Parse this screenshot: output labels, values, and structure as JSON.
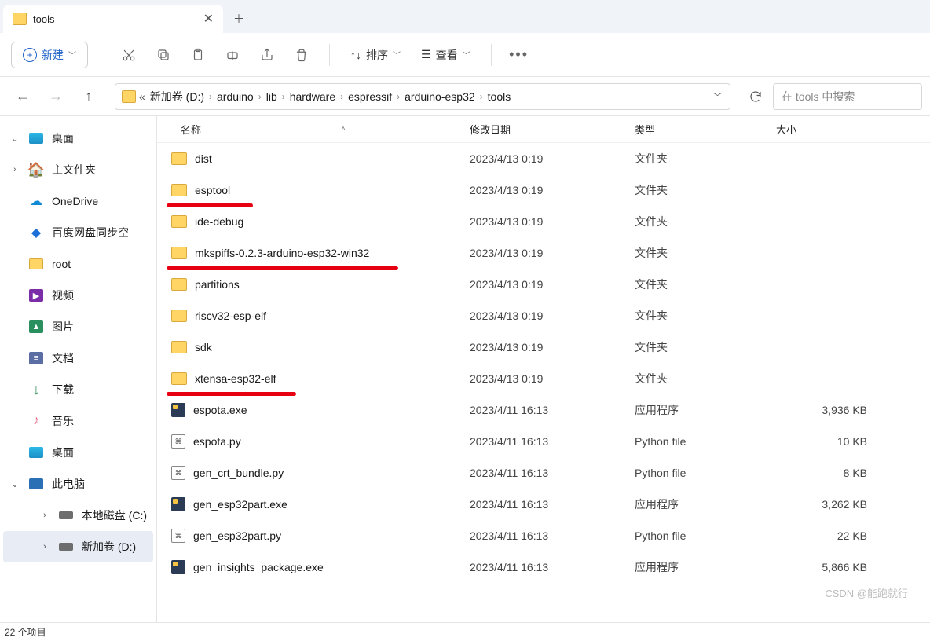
{
  "tab": {
    "title": "tools"
  },
  "toolbar": {
    "new_label": "新建",
    "sort_label": "排序",
    "view_label": "查看"
  },
  "breadcrumbs": {
    "prefix": "«",
    "segments": [
      "新加卷 (D:)",
      "arduino",
      "lib",
      "hardware",
      "espressif",
      "arduino-esp32",
      "tools"
    ]
  },
  "search": {
    "placeholder": "在 tools 中搜索"
  },
  "sidebar": [
    {
      "chev": "down",
      "icon": "desktop",
      "label": "桌面",
      "indent": false,
      "selected": false
    },
    {
      "chev": "right",
      "icon": "home",
      "label": "主文件夹",
      "indent": false,
      "selected": false
    },
    {
      "chev": "none",
      "icon": "onedrive",
      "label": "OneDrive",
      "indent": false,
      "selected": false
    },
    {
      "chev": "none",
      "icon": "baidu",
      "label": "百度网盘同步空",
      "indent": false,
      "selected": false
    },
    {
      "chev": "none",
      "icon": "folder",
      "label": "root",
      "indent": false,
      "selected": false
    },
    {
      "chev": "none",
      "icon": "video",
      "label": "视频",
      "indent": false,
      "selected": false
    },
    {
      "chev": "none",
      "icon": "image",
      "label": "图片",
      "indent": false,
      "selected": false
    },
    {
      "chev": "none",
      "icon": "doc",
      "label": "文档",
      "indent": false,
      "selected": false
    },
    {
      "chev": "none",
      "icon": "download",
      "label": "下载",
      "indent": false,
      "selected": false
    },
    {
      "chev": "none",
      "icon": "music",
      "label": "音乐",
      "indent": false,
      "selected": false
    },
    {
      "chev": "none",
      "icon": "desktop",
      "label": "桌面",
      "indent": false,
      "selected": false
    },
    {
      "chev": "down",
      "icon": "pc",
      "label": "此电脑",
      "indent": false,
      "selected": false
    },
    {
      "chev": "right",
      "icon": "disk",
      "label": "本地磁盘 (C:)",
      "indent": true,
      "selected": false
    },
    {
      "chev": "right",
      "icon": "disk",
      "label": "新加卷 (D:)",
      "indent": true,
      "selected": true
    }
  ],
  "columns": {
    "name": "名称",
    "date": "修改日期",
    "type": "类型",
    "size": "大小"
  },
  "files": [
    {
      "icon": "folder",
      "name": "dist",
      "date": "2023/4/13 0:19",
      "type": "文件夹",
      "size": "",
      "underline": false
    },
    {
      "icon": "folder",
      "name": "esptool",
      "date": "2023/4/13 0:19",
      "type": "文件夹",
      "size": "",
      "underline": true,
      "uw": 110
    },
    {
      "icon": "folder",
      "name": "ide-debug",
      "date": "2023/4/13 0:19",
      "type": "文件夹",
      "size": "",
      "underline": false
    },
    {
      "icon": "folder",
      "name": "mkspiffs-0.2.3-arduino-esp32-win32",
      "date": "2023/4/13 0:19",
      "type": "文件夹",
      "size": "",
      "underline": true,
      "uw": 295
    },
    {
      "icon": "folder",
      "name": "partitions",
      "date": "2023/4/13 0:19",
      "type": "文件夹",
      "size": "",
      "underline": false
    },
    {
      "icon": "folder",
      "name": "riscv32-esp-elf",
      "date": "2023/4/13 0:19",
      "type": "文件夹",
      "size": "",
      "underline": false
    },
    {
      "icon": "folder",
      "name": "sdk",
      "date": "2023/4/13 0:19",
      "type": "文件夹",
      "size": "",
      "underline": false
    },
    {
      "icon": "folder",
      "name": "xtensa-esp32-elf",
      "date": "2023/4/13 0:19",
      "type": "文件夹",
      "size": "",
      "underline": true,
      "uw": 165
    },
    {
      "icon": "exe",
      "name": "espota.exe",
      "date": "2023/4/11 16:13",
      "type": "应用程序",
      "size": "3,936 KB",
      "underline": false
    },
    {
      "icon": "py",
      "name": "espota.py",
      "date": "2023/4/11 16:13",
      "type": "Python file",
      "size": "10 KB",
      "underline": false
    },
    {
      "icon": "py",
      "name": "gen_crt_bundle.py",
      "date": "2023/4/11 16:13",
      "type": "Python file",
      "size": "8 KB",
      "underline": false
    },
    {
      "icon": "exe",
      "name": "gen_esp32part.exe",
      "date": "2023/4/11 16:13",
      "type": "应用程序",
      "size": "3,262 KB",
      "underline": false
    },
    {
      "icon": "py",
      "name": "gen_esp32part.py",
      "date": "2023/4/11 16:13",
      "type": "Python file",
      "size": "22 KB",
      "underline": false
    },
    {
      "icon": "exe",
      "name": "gen_insights_package.exe",
      "date": "2023/4/11 16:13",
      "type": "应用程序",
      "size": "5,866 KB",
      "underline": false
    }
  ],
  "status": {
    "count": "22 个项目"
  },
  "watermark": "CSDN @能跑就行"
}
